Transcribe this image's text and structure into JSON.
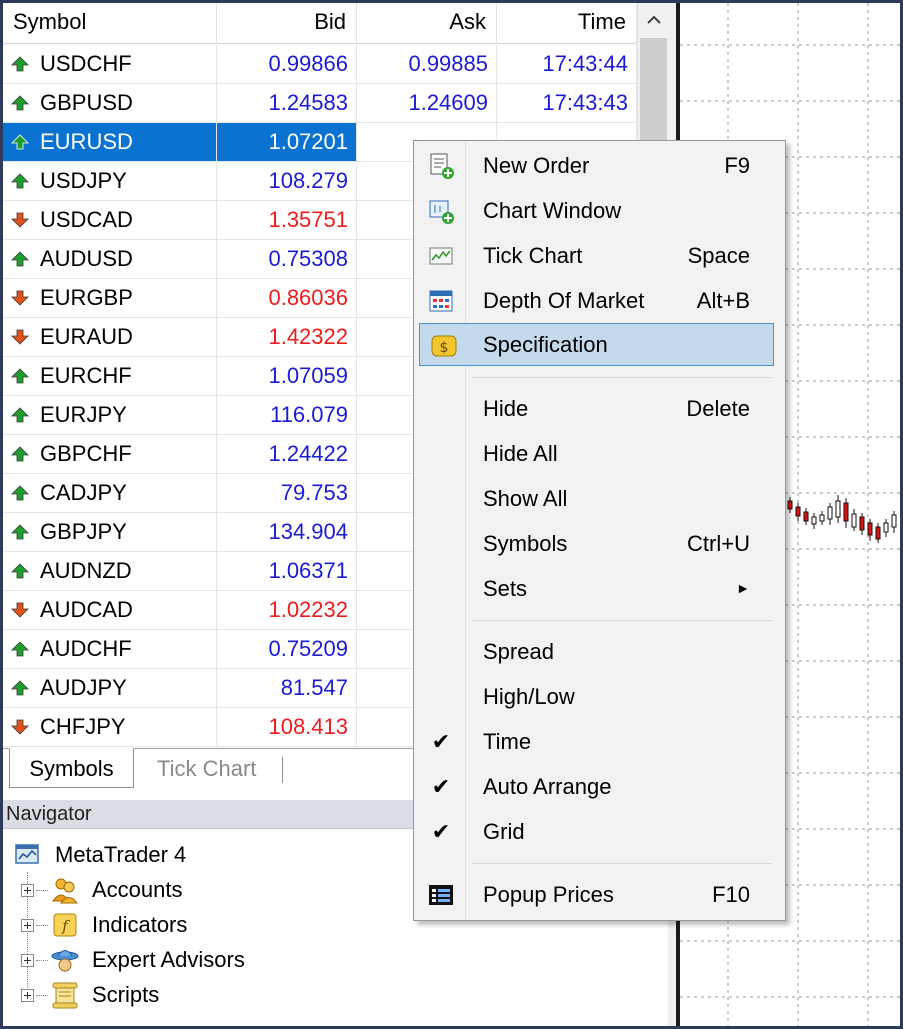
{
  "market_watch": {
    "headers": {
      "symbol": "Symbol",
      "bid": "Bid",
      "ask": "Ask",
      "time": "Time"
    },
    "rows": [
      {
        "symbol": "USDCHF",
        "bid": "0.99866",
        "ask": "0.99885",
        "time": "17:43:44",
        "dir": "up"
      },
      {
        "symbol": "GBPUSD",
        "bid": "1.24583",
        "ask": "1.24609",
        "time": "17:43:43",
        "dir": "up"
      },
      {
        "symbol": "EURUSD",
        "bid": "1.07201",
        "ask": "",
        "time": "",
        "dir": "up",
        "selected": true
      },
      {
        "symbol": "USDJPY",
        "bid": "108.279",
        "ask": "",
        "time": "",
        "dir": "up"
      },
      {
        "symbol": "USDCAD",
        "bid": "1.35751",
        "ask": "",
        "time": "",
        "dir": "down"
      },
      {
        "symbol": "AUDUSD",
        "bid": "0.75308",
        "ask": "",
        "time": "",
        "dir": "up"
      },
      {
        "symbol": "EURGBP",
        "bid": "0.86036",
        "ask": "",
        "time": "",
        "dir": "down"
      },
      {
        "symbol": "EURAUD",
        "bid": "1.42322",
        "ask": "",
        "time": "",
        "dir": "down"
      },
      {
        "symbol": "EURCHF",
        "bid": "1.07059",
        "ask": "",
        "time": "",
        "dir": "up"
      },
      {
        "symbol": "EURJPY",
        "bid": "116.079",
        "ask": "",
        "time": "",
        "dir": "up"
      },
      {
        "symbol": "GBPCHF",
        "bid": "1.24422",
        "ask": "",
        "time": "",
        "dir": "up"
      },
      {
        "symbol": "CADJPY",
        "bid": "79.753",
        "ask": "",
        "time": "",
        "dir": "up"
      },
      {
        "symbol": "GBPJPY",
        "bid": "134.904",
        "ask": "",
        "time": "",
        "dir": "up"
      },
      {
        "symbol": "AUDNZD",
        "bid": "1.06371",
        "ask": "",
        "time": "",
        "dir": "up"
      },
      {
        "symbol": "AUDCAD",
        "bid": "1.02232",
        "ask": "",
        "time": "",
        "dir": "down"
      },
      {
        "symbol": "AUDCHF",
        "bid": "0.75209",
        "ask": "",
        "time": "",
        "dir": "up"
      },
      {
        "symbol": "AUDJPY",
        "bid": "81.547",
        "ask": "",
        "time": "",
        "dir": "up"
      },
      {
        "symbol": "CHFJPY",
        "bid": "108.413",
        "ask": "",
        "time": "",
        "dir": "down"
      }
    ],
    "tabs": {
      "active": "Symbols",
      "inactive": "Tick Chart"
    }
  },
  "navigator": {
    "title": "Navigator",
    "root": "MetaTrader 4",
    "items": [
      "Accounts",
      "Indicators",
      "Expert Advisors",
      "Scripts"
    ]
  },
  "context_menu": {
    "items": [
      {
        "label": "New Order",
        "shortcut": "F9",
        "icon": "new-order-icon"
      },
      {
        "label": "Chart Window",
        "shortcut": "",
        "icon": "chart-window-icon"
      },
      {
        "label": "Tick Chart",
        "shortcut": "Space",
        "icon": "tick-chart-icon"
      },
      {
        "label": "Depth Of Market",
        "shortcut": "Alt+B",
        "icon": "depth-of-market-icon"
      },
      {
        "label": "Specification",
        "shortcut": "",
        "icon": "specification-icon",
        "highlighted": true
      },
      {
        "label": "Hide",
        "shortcut": "Delete"
      },
      {
        "label": "Hide All",
        "shortcut": ""
      },
      {
        "label": "Show All",
        "shortcut": ""
      },
      {
        "label": "Symbols",
        "shortcut": "Ctrl+U"
      },
      {
        "label": "Sets",
        "shortcut": "",
        "submenu": true
      },
      {
        "label": "Spread",
        "shortcut": ""
      },
      {
        "label": "High/Low",
        "shortcut": ""
      },
      {
        "label": "Time",
        "shortcut": "",
        "checked": true
      },
      {
        "label": "Auto Arrange",
        "shortcut": "",
        "checked": true
      },
      {
        "label": "Grid",
        "shortcut": "",
        "checked": true
      },
      {
        "label": "Popup Prices",
        "shortcut": "F10",
        "icon": "popup-prices-icon"
      }
    ]
  },
  "colors": {
    "up_price": "#1b1bd6",
    "down_price": "#ee1c1c",
    "selection": "#0a73d1",
    "menu_highlight": "#c5d9ec",
    "up_arrow": "#1e9e2e",
    "down_arrow": "#e0521c"
  }
}
